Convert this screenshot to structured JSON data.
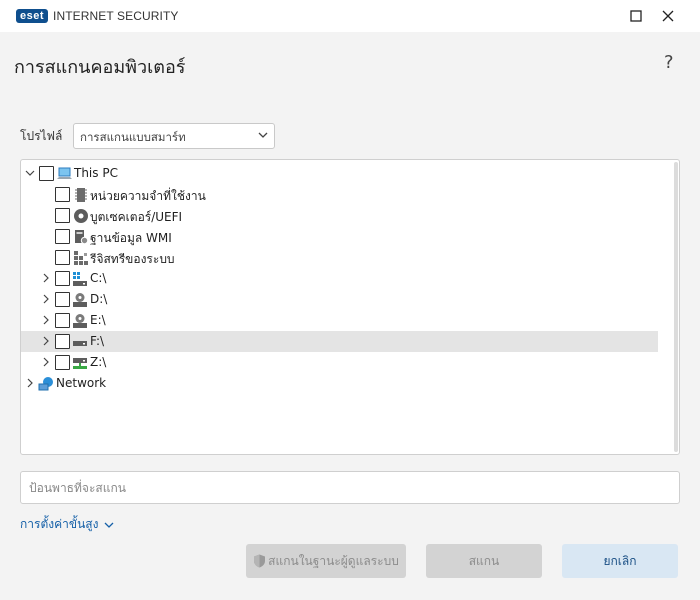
{
  "window": {
    "logo_text": "eset",
    "product_name": "INTERNET SECURITY",
    "minimize_label": "Minimize",
    "close_label": "Close"
  },
  "header": {
    "title": "การสแกนคอมพิวเตอร์",
    "help": "?"
  },
  "profile": {
    "label": "โปรไฟล์",
    "selected": "การสแกนแบบสมาร์ท"
  },
  "tree": {
    "root": {
      "label": "This PC",
      "expanded": true,
      "checked": false
    },
    "memory": {
      "label": "หน่วยความจำที่ใช้งาน",
      "checked": false
    },
    "boot": {
      "label": "บูตเซคเตอร์/UEFI",
      "checked": false
    },
    "wmi": {
      "label": "ฐานข้อมูล WMI",
      "checked": false
    },
    "registry": {
      "label": "รีจิสทรีของระบบ",
      "checked": false
    },
    "drives": [
      {
        "label": "C:\\",
        "checked": false,
        "selected": false
      },
      {
        "label": "D:\\",
        "checked": false,
        "selected": false
      },
      {
        "label": "E:\\",
        "checked": false,
        "selected": false
      },
      {
        "label": "F:\\",
        "checked": false,
        "selected": true
      },
      {
        "label": "Z:\\",
        "checked": false,
        "selected": false
      }
    ],
    "network": {
      "label": "Network",
      "expanded": false
    }
  },
  "path_input": {
    "value": "",
    "placeholder": "ป้อนพาธที่จะสแกน"
  },
  "advanced": {
    "label": "การตั้งค่าขั้นสูง"
  },
  "buttons": {
    "admin_scan": "สแกนในฐานะผู้ดูแลระบบ",
    "scan": "สแกน",
    "cancel": "ยกเลิก"
  },
  "colors": {
    "brand": "#0f4f8e",
    "link": "#1560a8",
    "cancel_bg": "#d9e7f3",
    "selected_row": "#e4e4e4",
    "disabled_bg": "#d3d3d3"
  }
}
